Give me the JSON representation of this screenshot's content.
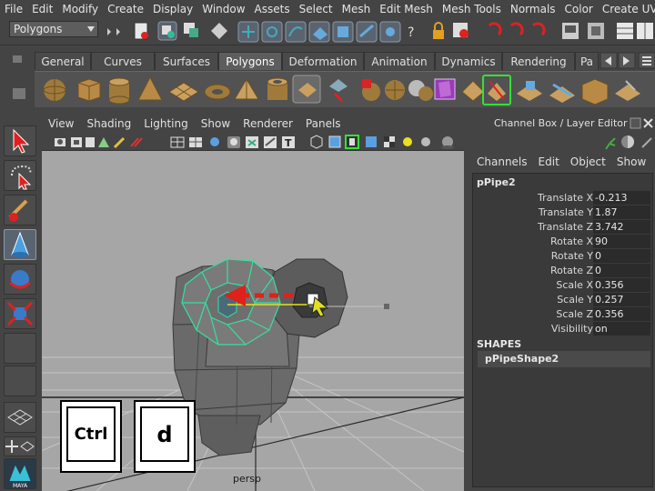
{
  "menubar": {
    "items": [
      "File",
      "Edit",
      "Modify",
      "Create",
      "Display",
      "Window",
      "Assets",
      "Select",
      "Mesh",
      "Edit Mesh",
      "Mesh Tools",
      "Normals",
      "Color",
      "Create UVs"
    ]
  },
  "status_line": {
    "mode": "Polygons"
  },
  "shelf": {
    "tabs": [
      "General",
      "Curves",
      "Surfaces",
      "Polygons",
      "Deformation",
      "Animation",
      "Dynamics",
      "Rendering",
      "Pa"
    ],
    "active_tab": "Polygons"
  },
  "viewport": {
    "menu": [
      "View",
      "Shading",
      "Lighting",
      "Show",
      "Renderer",
      "Panels"
    ],
    "camera_label": "persp"
  },
  "keys": {
    "ctrl": "Ctrl",
    "d": "d"
  },
  "channel_box": {
    "title": "Channel Box / Layer Editor",
    "menu": [
      "Channels",
      "Edit",
      "Object",
      "Show"
    ],
    "object": "pPipe2",
    "attributes": [
      {
        "name": "Translate X",
        "value": "-0.213"
      },
      {
        "name": "Translate Y",
        "value": "1.87"
      },
      {
        "name": "Translate Z",
        "value": "3.742"
      },
      {
        "name": "Rotate X",
        "value": "90"
      },
      {
        "name": "Rotate Y",
        "value": "0"
      },
      {
        "name": "Rotate Z",
        "value": "0"
      },
      {
        "name": "Scale X",
        "value": "0.356"
      },
      {
        "name": "Scale Y",
        "value": "0.257"
      },
      {
        "name": "Scale Z",
        "value": "0.356"
      },
      {
        "name": "Visibility",
        "value": "on"
      }
    ],
    "shapes_label": "SHAPES",
    "shape_name": "pPipeShape2"
  },
  "colors": {
    "accent_selected": "#35e0a0",
    "arrow_red": "#e0201a",
    "ui_bg": "#444444",
    "viewport_bg": "#a6a6a6"
  }
}
